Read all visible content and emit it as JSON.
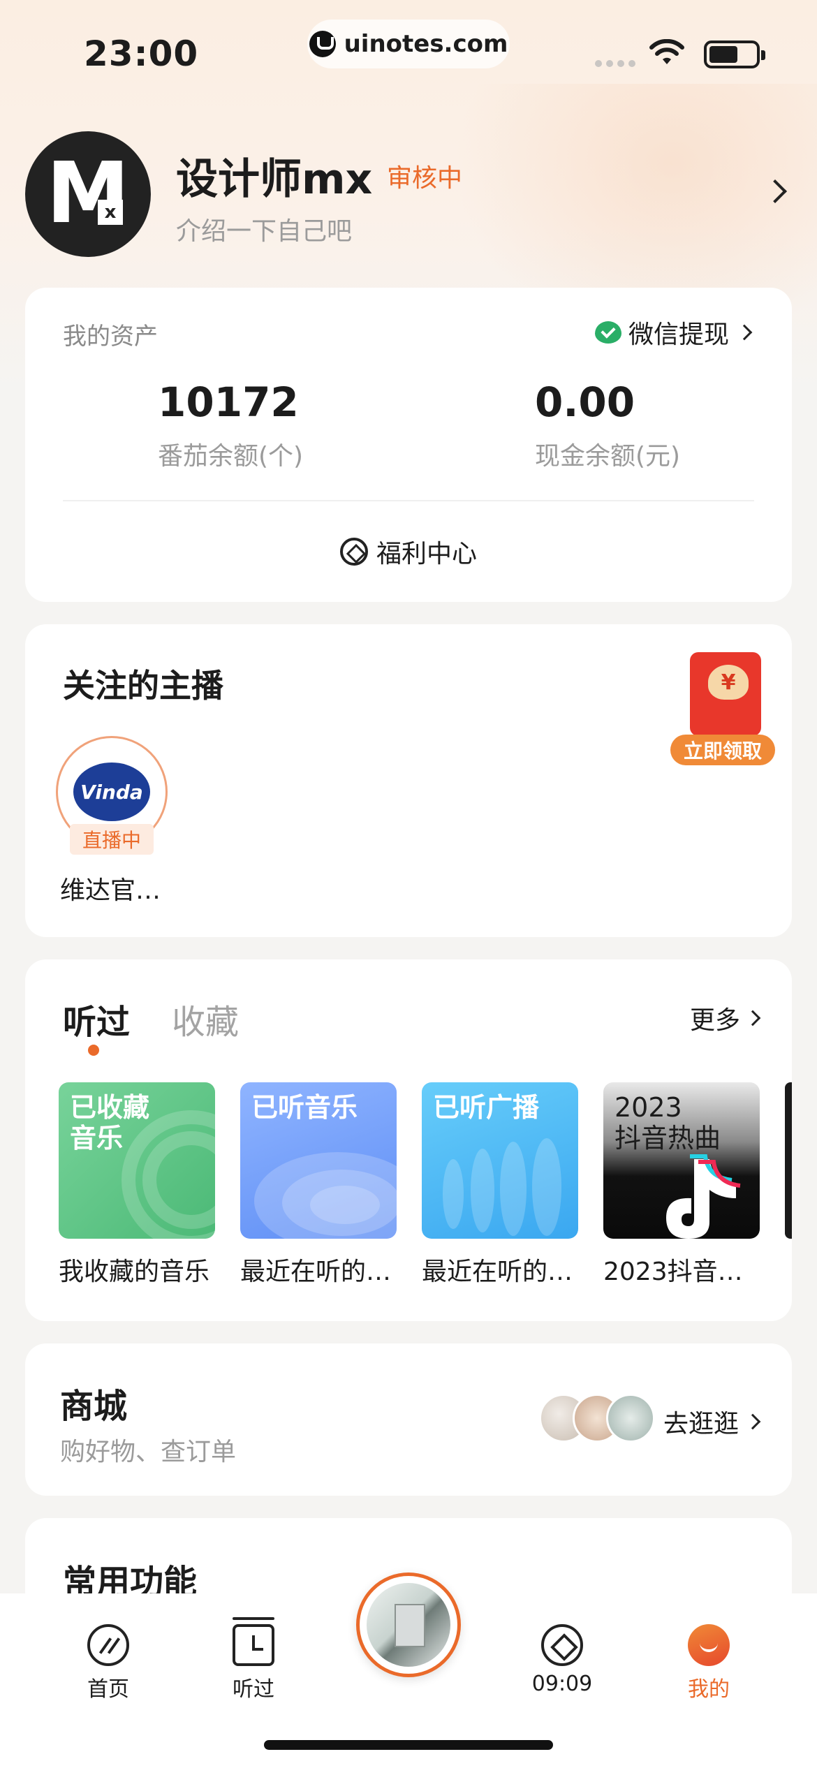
{
  "status_bar": {
    "time": "23:00",
    "url": "uinotes.com"
  },
  "profile": {
    "avatar_letter": "M",
    "avatar_sub": "x",
    "name": "设计师mx",
    "review_status": "审核中",
    "bio": "介绍一下自己吧"
  },
  "assets": {
    "title": "我的资产",
    "withdraw_label": "微信提现",
    "tomato_balance": "10172",
    "tomato_label": "番茄余额(个)",
    "cash_balance": "0.00",
    "cash_label": "现金余额(元)",
    "welfare_label": "福利中心"
  },
  "follow": {
    "title": "关注的主播",
    "redpack_symbol": "¥",
    "redpack_label": "立即领取",
    "anchor": {
      "logo_text": "Vinda",
      "live_label": "直播中",
      "name": "维达官…"
    }
  },
  "history": {
    "tab_active": "听过",
    "tab_inactive": "收藏",
    "more_label": "更多",
    "items": [
      {
        "cover_text_1": "已收藏",
        "cover_text_2": "音乐",
        "caption": "我收藏的音乐"
      },
      {
        "cover_text_1": "已听音乐",
        "cover_text_2": "",
        "caption": "最近在听的…"
      },
      {
        "cover_text_1": "已听广播",
        "cover_text_2": "",
        "caption": "最近在听的…"
      },
      {
        "cover_text_1": "2023",
        "cover_text_2": "抖音热曲",
        "caption": "2023抖音…"
      }
    ]
  },
  "shop": {
    "title": "商城",
    "subtitle": "购好物、查订单",
    "link_label": "去逛逛"
  },
  "common": {
    "title": "常用功能"
  },
  "tab_bar": {
    "items": [
      {
        "label": "首页",
        "icon": "home-icon"
      },
      {
        "label": "听过",
        "icon": "history-icon"
      },
      {
        "label": "09:09",
        "icon": "explore-icon"
      },
      {
        "label": "我的",
        "icon": "me-icon"
      }
    ],
    "active_color": "#ea6a2a"
  },
  "colors": {
    "accent": "#ea6a2a",
    "wechat_green": "#2aae67"
  }
}
